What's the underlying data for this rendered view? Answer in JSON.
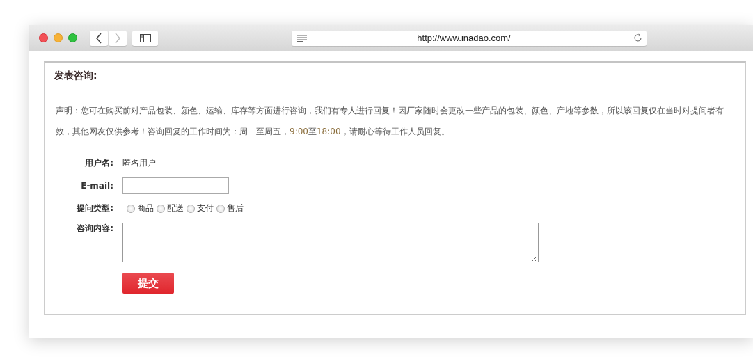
{
  "browser": {
    "url": "http://www.inadao.com/",
    "back_disabled": false,
    "forward_disabled": true
  },
  "form": {
    "title": "发表咨询:",
    "notice": [
      {
        "kind": "text",
        "text": "声明：您可在购买前对产品包装、颜色、运输、库存等方面进行咨询，我们有专人进行回复！因厂家随时会更改一些产品的包装、颜色、产地等参数，所以该回复仅在当时对提问者有效，其他网友仅供参考！咨询回复的工作时间为：周一至周五，"
      },
      {
        "kind": "time",
        "text": "9:00"
      },
      {
        "kind": "text",
        "text": "至"
      },
      {
        "kind": "time",
        "text": "18:00"
      },
      {
        "kind": "text",
        "text": "，请耐心等待工作人员回复。"
      }
    ],
    "username": {
      "label": "用户名:",
      "value": "匿名用户"
    },
    "email": {
      "label": "E-mail:"
    },
    "question_type": {
      "label": "提问类型:",
      "options": [
        {
          "label": "商品",
          "selected": false
        },
        {
          "label": "配送",
          "selected": false
        },
        {
          "label": "支付",
          "selected": false
        },
        {
          "label": "售后",
          "selected": false
        }
      ]
    },
    "content": {
      "label": "咨询内容:"
    },
    "submit": "提交"
  }
}
